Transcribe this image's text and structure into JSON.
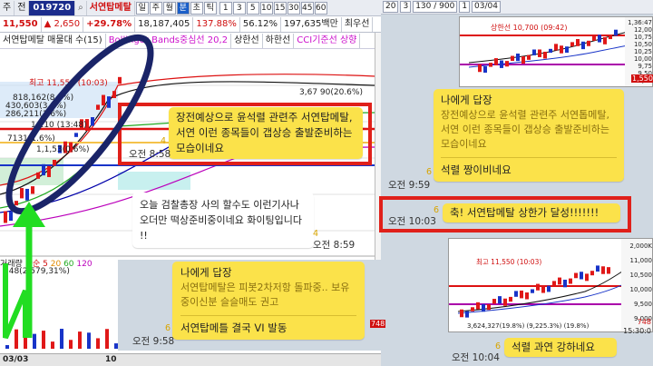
{
  "toolbar": {
    "market": "주",
    "period": "전",
    "code": "019720",
    "name": "서연탑메탈",
    "period_buttons": [
      "일",
      "주",
      "월",
      "분",
      "초",
      "틱"
    ],
    "active_period": "분",
    "minute_buttons": [
      "1",
      "3",
      "5",
      "10",
      "15",
      "30",
      "45",
      "60"
    ],
    "price": "11,550",
    "change": "2,650",
    "change_pct": "+29.78%",
    "volume": "18,187,405",
    "ratio_a": "137.88%",
    "ratio_b": "56.12%",
    "amount": "197,635백만",
    "priority": "최우선"
  },
  "indicators": {
    "chart_title": "서연탑메탈 매물대 수(15)",
    "bollinger": "Bollinger Bands중심선 20,2",
    "upper": "상한선",
    "lower": "하한선",
    "cci": "CCI기준선 상향"
  },
  "chart_labels": {
    "high": "최고 11,550 (10:03)",
    "l1": "818,162(8.5%)",
    "l2": "430,603(3.9%)",
    "l3": "286,211(1.6%)",
    "l4": "1,210 (13:48)",
    "l5": "7131(1.6%)",
    "l6": "1,1,53(0.6%)",
    "l7": "3,67 90(20.6%)",
    "l8": "748",
    "vol_header_a": "거래량",
    "vol_header_b": "단순 5",
    "vol_header_ma": [
      "20",
      "60",
      "120"
    ],
    "vol_value": "748(2,579,31%)",
    "date_left": "03/03",
    "date_mid": "10",
    "price_tag": "1,550"
  },
  "right_toolbar": {
    "v1": "20",
    "v2": "3",
    "v3": "130 / 900",
    "v4": "1",
    "v5": "03/04"
  },
  "right_axis": [
    "1,36:47",
    "12,00",
    "10,75",
    "10,50",
    "10,25",
    "10,00",
    "9,75",
    "9,50",
    "9,25"
  ],
  "right_axis2": [
    "2,000K",
    "11,000",
    "10,500",
    "10,000",
    "9,500",
    "9,000"
  ],
  "right_axis2_bottom": [
    "748",
    "15:30:0"
  ],
  "thumbs": {
    "t1_label": "상한선 10,700 (09:42)",
    "t2_label": "최고 11,550 (10:03)",
    "t2_bottom": "3,624,327(19.8%)  (9,225.3%) (19.8%)"
  },
  "chat": {
    "m1": {
      "text": "장전예상으로 윤석렬 관련주 서연탑메탈, 서연 이런 종목들이 갭상승 출발준비하는 모습이네요",
      "time": "오전 8:58",
      "unread": "4"
    },
    "m2": {
      "text": "오늘 검찰총장 사의 할수도 이런기사나오더만 떡상준비중이네요 화이팅입니다 !!",
      "time": "오전 8:59",
      "unread": "4"
    },
    "m3": {
      "reply_head": "나에게 답장",
      "reply_quote": "서연탑메탈은 피봇2차저항 돌파중.. 보유중이신분 슬슬매도 권고",
      "text": "서연탑메틀 결국 VI 발동",
      "time": "오전 9:58",
      "unread": "6"
    },
    "r1": {
      "reply_head": "나에게 답장",
      "reply_quote": "장전예상으로 윤석렬 관련주 서연톱메탈, 서연 이런 종목들이 갭상승 출발준비하는 모습이네요",
      "text": "석렬 짱이비네요",
      "time": "오전 9:59",
      "unread": "6"
    },
    "r2": {
      "text": "축! 서연탑메탈 상한가 달성!!!!!!!",
      "time": "오전 10:03",
      "unread": "6"
    },
    "r3": {
      "text": "석렬 과연 강하네요",
      "time": "오전 10:04",
      "unread": "6"
    }
  },
  "colors": {
    "highlight_box": "#e0201a",
    "bubble": "#fbe24a",
    "ellipse": "#1a2468",
    "arrow": "#22dd22"
  }
}
